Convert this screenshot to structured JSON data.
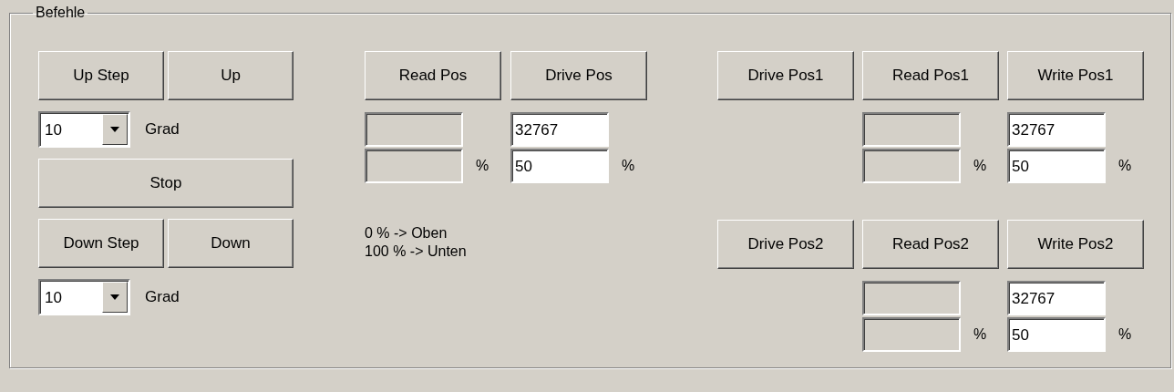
{
  "group": {
    "title": "Befehle"
  },
  "manual": {
    "top_buttons": [
      "Up Step",
      "Up"
    ],
    "step_up": {
      "value": "10",
      "unit": "Grad"
    },
    "stop_button": "Stop",
    "bottom_buttons": [
      "Down Step",
      "Down"
    ],
    "step_down": {
      "value": "10",
      "unit": "Grad"
    }
  },
  "position": {
    "buttons": [
      "Read Pos",
      "Drive Pos"
    ],
    "read_unit": "%",
    "target_raw": "32767",
    "target_percent": "50",
    "target_unit": "%",
    "notes": [
      "0 % -> Oben",
      "100 % -> Unten"
    ]
  },
  "presets": [
    {
      "buttons": [
        "Drive Pos1",
        "Read Pos1",
        "Write Pos1"
      ],
      "read_unit": "%",
      "write_raw": "32767",
      "write_percent": "50",
      "write_unit": "%"
    },
    {
      "buttons": [
        "Drive Pos2",
        "Read Pos2",
        "Write Pos2"
      ],
      "read_unit": "%",
      "write_raw": "32767",
      "write_percent": "50",
      "write_unit": "%"
    }
  ]
}
